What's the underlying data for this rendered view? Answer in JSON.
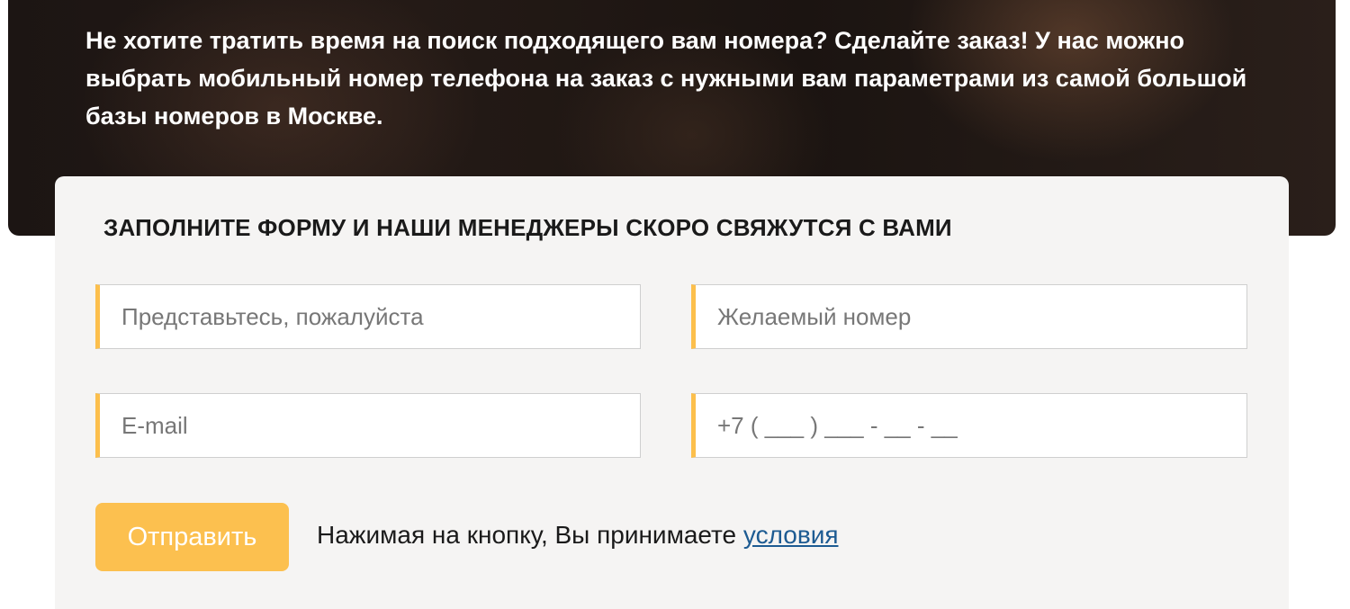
{
  "hero": {
    "text": "Не хотите тратить время на поиск подходящего вам номера? Сделайте заказ! У нас можно выбрать мобильный номер телефона на заказ с нужными вам параметрами из самой большой базы номеров в Москве."
  },
  "form": {
    "title": "ЗАПОЛНИТЕ ФОРМУ И НАШИ МЕНЕДЖЕРЫ СКОРО СВЯЖУТСЯ С ВАМИ",
    "fields": {
      "name": {
        "placeholder": "Представьтесь, пожалуйста",
        "value": ""
      },
      "desired_number": {
        "placeholder": "Желаемый номер",
        "value": ""
      },
      "email": {
        "placeholder": "E-mail",
        "value": ""
      },
      "phone": {
        "placeholder": "+7 ( ___ ) ___ - __ - __",
        "value": ""
      }
    },
    "submit_label": "Отправить",
    "consent_text": "Нажимая на кнопку, Вы принимаете ",
    "consent_link": "условия"
  },
  "colors": {
    "accent": "#fcbf4c",
    "link": "#1d5b92",
    "card_bg": "#f5f4f3"
  }
}
